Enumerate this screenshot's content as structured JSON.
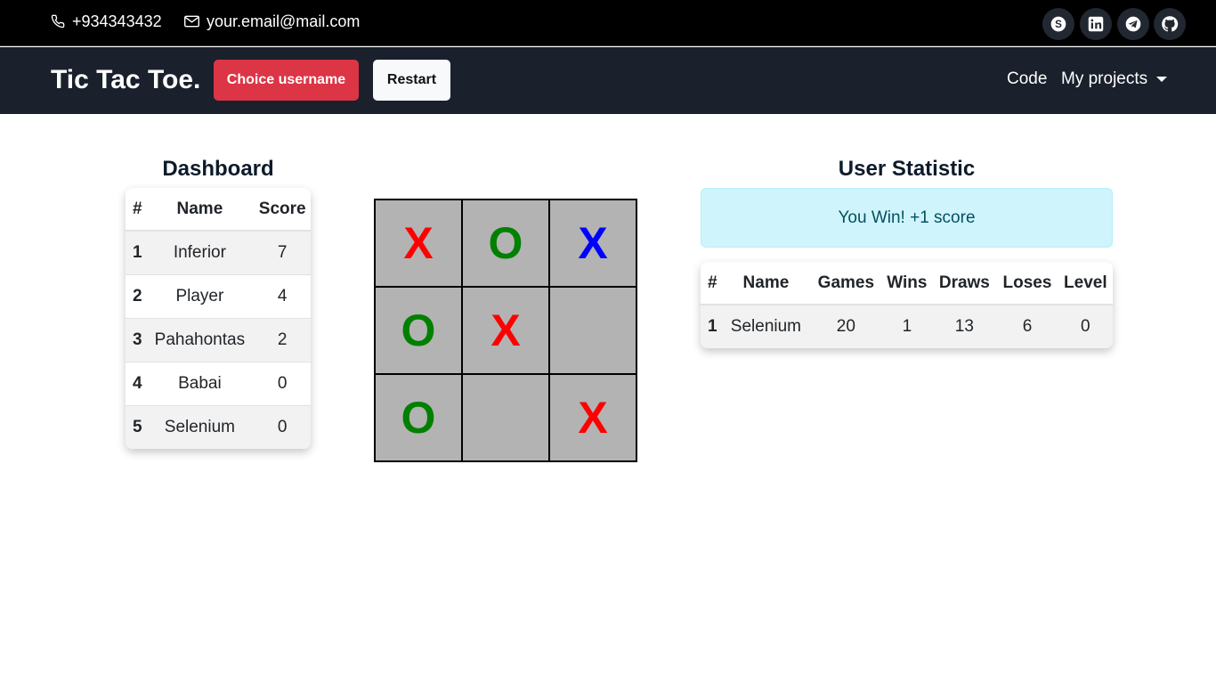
{
  "topbar": {
    "phone": "+934343432",
    "email": "your.email@mail.com",
    "social": [
      "skype-icon",
      "linkedin-icon",
      "telegram-icon",
      "github-icon"
    ]
  },
  "navbar": {
    "brand": "Tic Tac Toe.",
    "choice_username": "Choice username",
    "restart": "Restart",
    "code": "Code",
    "my_projects": "My projects"
  },
  "dashboard": {
    "title": "Dashboard",
    "headers": [
      "#",
      "Name",
      "Score"
    ],
    "rows": [
      {
        "num": "1",
        "name": "Inferior",
        "score": "7"
      },
      {
        "num": "2",
        "name": "Player",
        "score": "4"
      },
      {
        "num": "3",
        "name": "Pahahontas",
        "score": "2"
      },
      {
        "num": "4",
        "name": "Babai",
        "score": "0"
      },
      {
        "num": "5",
        "name": "Selenium",
        "score": "0"
      }
    ]
  },
  "board": {
    "cells": [
      "X",
      "O",
      "X",
      "O",
      "X",
      "",
      "O",
      "",
      "X"
    ],
    "colors": {
      "x": "#ff0000",
      "x_highlight": "#0000ff",
      "o": "#008000",
      "cell": "#b3b3b3"
    }
  },
  "user_statistic": {
    "title": "User Statistic",
    "alert": "You Win! +1 score",
    "headers": [
      "#",
      "Name",
      "Games",
      "Wins",
      "Draws",
      "Loses",
      "Level"
    ],
    "rows": [
      {
        "num": "1",
        "name": "Selenium",
        "games": "20",
        "wins": "1",
        "draws": "13",
        "loses": "6",
        "level": "0"
      }
    ]
  },
  "colors": {
    "topbar": "#000000",
    "navbar": "#1a202c",
    "danger": "#dc3545",
    "light": "#f8f9fa",
    "alert_bg": "#cff4fc",
    "alert_text": "#055160"
  }
}
